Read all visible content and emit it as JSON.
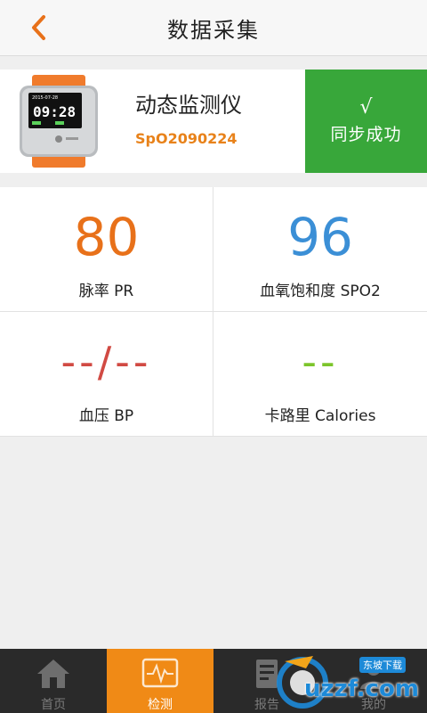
{
  "header": {
    "title": "数据采集"
  },
  "device": {
    "name": "动态监测仪",
    "id": "SpO2090224",
    "screen_date": "2015-07-28",
    "screen_time": "09:28",
    "sync_check": "√",
    "sync_label": "同步成功"
  },
  "metrics": [
    {
      "value": "80",
      "label": "脉率 PR",
      "color": "#e8711a"
    },
    {
      "value": "96",
      "label": "血氧饱和度 SPO2",
      "color": "#3b8fd6"
    },
    {
      "value": "--/--",
      "label": "血压 BP",
      "color": "#d14a43"
    },
    {
      "value": "--",
      "label": "卡路里 Calories",
      "color": "#7cc52b"
    }
  ],
  "tabs": [
    {
      "label": "首页",
      "icon": "home-icon"
    },
    {
      "label": "检测",
      "icon": "pulse-monitor-icon"
    },
    {
      "label": "报告",
      "icon": "report-icon"
    },
    {
      "label": "我的",
      "icon": "user-icon"
    }
  ],
  "watermark": {
    "text": "uzzf.com",
    "tag": "东坡下载"
  },
  "colors": {
    "accent": "#f08a16",
    "sync_green": "#38a73a"
  }
}
